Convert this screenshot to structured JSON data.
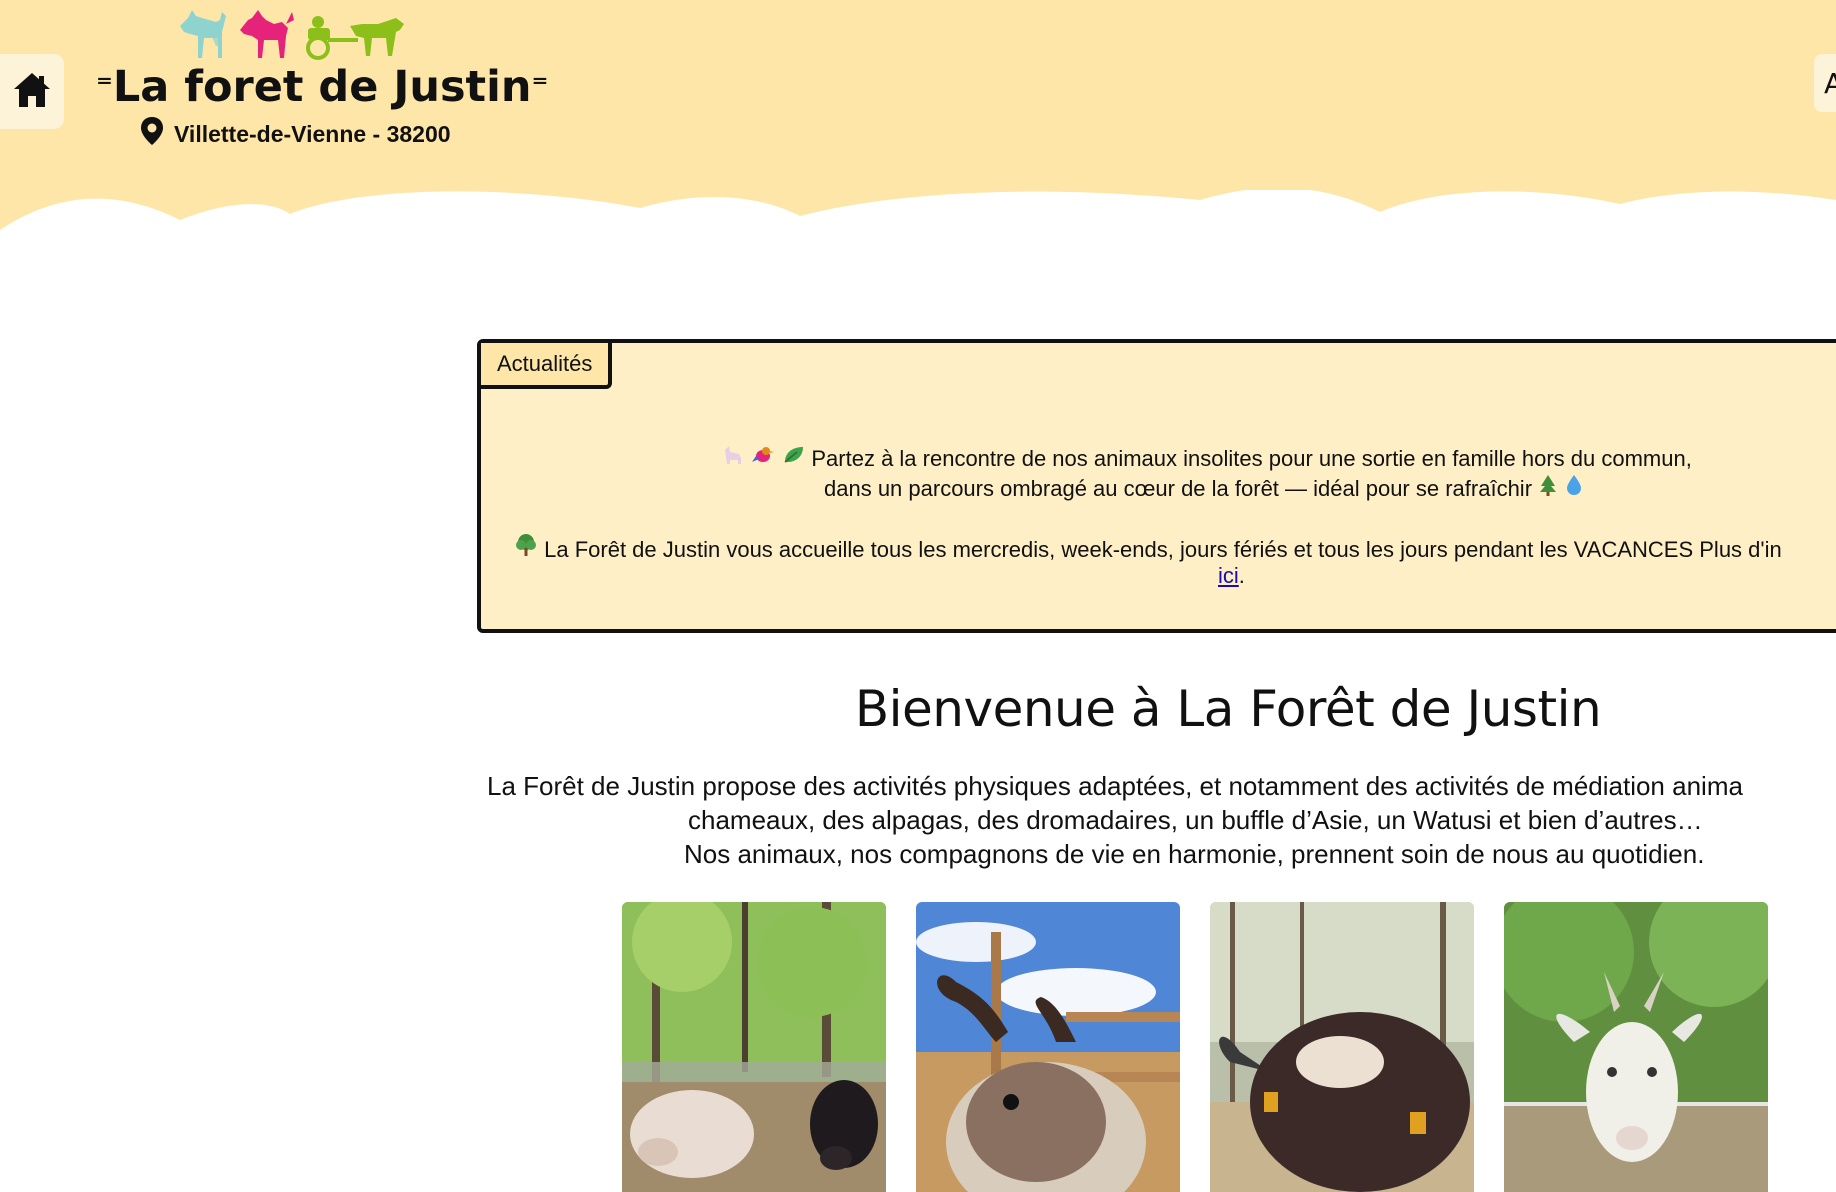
{
  "header": {
    "site_title": "La foret de Justin",
    "location": "Villette-de-Vienne - 38200",
    "right_button_label": "A"
  },
  "icons": {
    "home": "home-icon",
    "location": "map-pin-icon",
    "emoji_line1": [
      "llama-emoji",
      "bird-emoji",
      "leaf-emoji"
    ],
    "emoji_line1_end": [
      "tree-emoji",
      "droplet-emoji"
    ],
    "emoji_line2": "tree-emoji"
  },
  "news": {
    "tab_label": "Actualités",
    "line1": "Partez à la rencontre de nos animaux insolites pour une sortie en famille hors du commun,",
    "line2": "dans un parcours ombragé au cœur de la forêt — idéal pour se rafraîchir",
    "line3": "La Forêt de Justin vous accueille tous les mercredis, week-ends, jours fériés et tous les jours pendant les VACANCES  Plus d'in",
    "link_text": "ici",
    "link_suffix": "."
  },
  "main": {
    "title": "Bienvenue à La Forêt de Justin",
    "intro_line1": "La Forêt de Justin propose des activités physiques adaptées, et notamment des activités de médiation anima",
    "intro_line2": "chameaux, des alpagas, des dromadaires, un buffle d’Asie, un Watusi et bien d’autres…",
    "intro_line3": "Nos animaux, nos compagnons de vie en harmonie, prennent soin de nous au quotidien."
  },
  "photos": [
    {
      "subject": "pigs-photo"
    },
    {
      "subject": "reindeer-photo"
    },
    {
      "subject": "buffalo-photo"
    },
    {
      "subject": "goat-photo"
    }
  ],
  "colors": {
    "header_bg": "#fee6a8",
    "news_bg": "#feefc6",
    "logo_blue": "#8fd3cf",
    "logo_pink": "#e5237a",
    "logo_green": "#8cbf1a"
  }
}
